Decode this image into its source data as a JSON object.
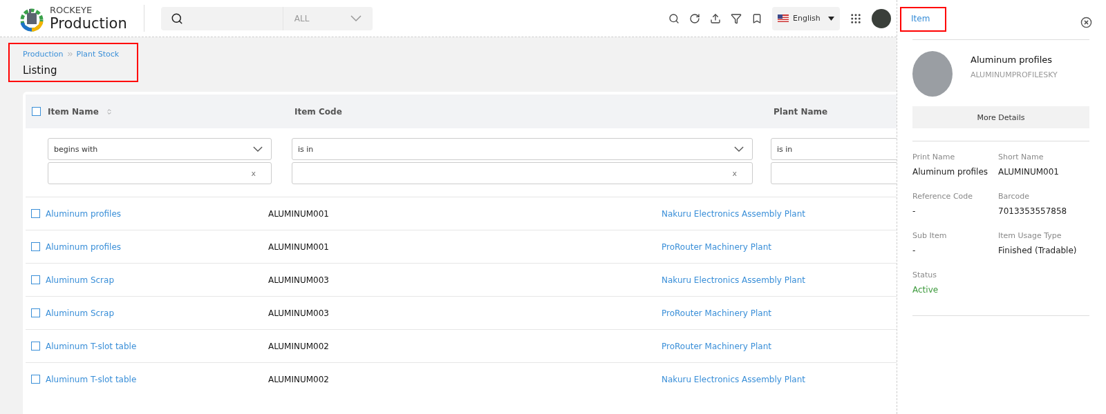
{
  "header": {
    "brand_small": "ROCKEYE",
    "brand_large": "Production",
    "search": {
      "scope": "ALL"
    },
    "language": "English"
  },
  "breadcrumb": [
    "Production",
    "Plant Stock"
  ],
  "page_title": "Listing",
  "table": {
    "select_all": {
      "checked": false
    },
    "columns": [
      {
        "label": "Item Name",
        "sortable": true
      },
      {
        "label": "Item Code",
        "sortable": false
      },
      {
        "label": "Plant Name",
        "sortable": false
      }
    ],
    "filters": [
      {
        "operator": "begins with",
        "clear": "x"
      },
      {
        "operator": "is in",
        "clear": "x"
      },
      {
        "operator": "is in"
      }
    ],
    "rows": [
      {
        "checked": false,
        "item_name": "Aluminum profiles",
        "item_code": "ALUMINUM001",
        "plant_name": "Nakuru Electronics Assembly Plant"
      },
      {
        "checked": false,
        "item_name": "Aluminum profiles",
        "item_code": "ALUMINUM001",
        "plant_name": "ProRouter Machinery Plant"
      },
      {
        "checked": false,
        "item_name": "Aluminum Scrap",
        "item_code": "ALUMINUM003",
        "plant_name": "Nakuru Electronics Assembly Plant"
      },
      {
        "checked": false,
        "item_name": "Aluminum Scrap",
        "item_code": "ALUMINUM003",
        "plant_name": "ProRouter Machinery Plant"
      },
      {
        "checked": false,
        "item_name": "Aluminum T-slot table",
        "item_code": "ALUMINUM002",
        "plant_name": "ProRouter Machinery Plant"
      },
      {
        "checked": false,
        "item_name": "Aluminum T-slot table",
        "item_code": "ALUMINUM002",
        "plant_name": "Nakuru Electronics Assembly Plant"
      }
    ]
  },
  "panel": {
    "tab": "Item",
    "item_name": "Aluminum profiles",
    "item_key": "ALUMINUMPROFILESKY",
    "more_button": "More Details",
    "fields": [
      {
        "label": "Print Name",
        "value": "Aluminum profiles"
      },
      {
        "label": "Short Name",
        "value": "ALUMINUM001"
      },
      {
        "label": "Reference Code",
        "value": "-"
      },
      {
        "label": "Barcode",
        "value": "7013353557858"
      },
      {
        "label": "Sub Item",
        "value": "-"
      },
      {
        "label": "Item Usage Type",
        "value": "Finished (Tradable)"
      },
      {
        "label": "Status",
        "value": "Active",
        "kind": "status"
      }
    ]
  }
}
